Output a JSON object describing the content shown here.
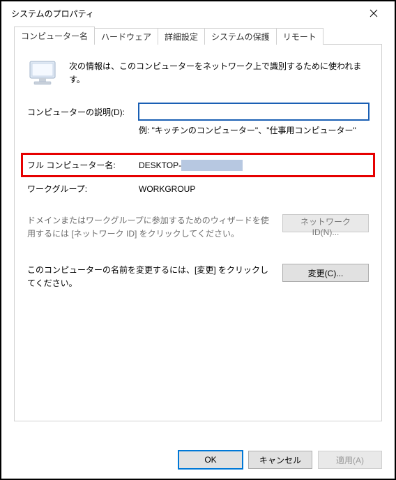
{
  "window": {
    "title": "システムのプロパティ"
  },
  "tabs": [
    {
      "label": "コンピューター名",
      "active": true
    },
    {
      "label": "ハードウェア",
      "active": false
    },
    {
      "label": "詳細設定",
      "active": false
    },
    {
      "label": "システムの保護",
      "active": false
    },
    {
      "label": "リモート",
      "active": false
    }
  ],
  "intro": "次の情報は、このコンピューターをネットワーク上で識別するために使われます。",
  "description": {
    "label": "コンピューターの説明(D):",
    "value": "",
    "example": "例: \"キッチンのコンピューター\"、\"仕事用コンピューター\""
  },
  "full_name": {
    "label": "フル コンピューター名:",
    "value_prefix": "DESKTOP-"
  },
  "workgroup": {
    "label": "ワークグループ:",
    "value": "WORKGROUP"
  },
  "network_id": {
    "text": "ドメインまたはワークグループに参加するためのウィザードを使用するには [ネットワーク ID] をクリックしてください。",
    "button": "ネットワーク ID(N)..."
  },
  "change": {
    "text": "このコンピューターの名前を変更するには、[変更] をクリックしてください。",
    "button": "変更(C)..."
  },
  "buttons": {
    "ok": "OK",
    "cancel": "キャンセル",
    "apply": "適用(A)"
  }
}
